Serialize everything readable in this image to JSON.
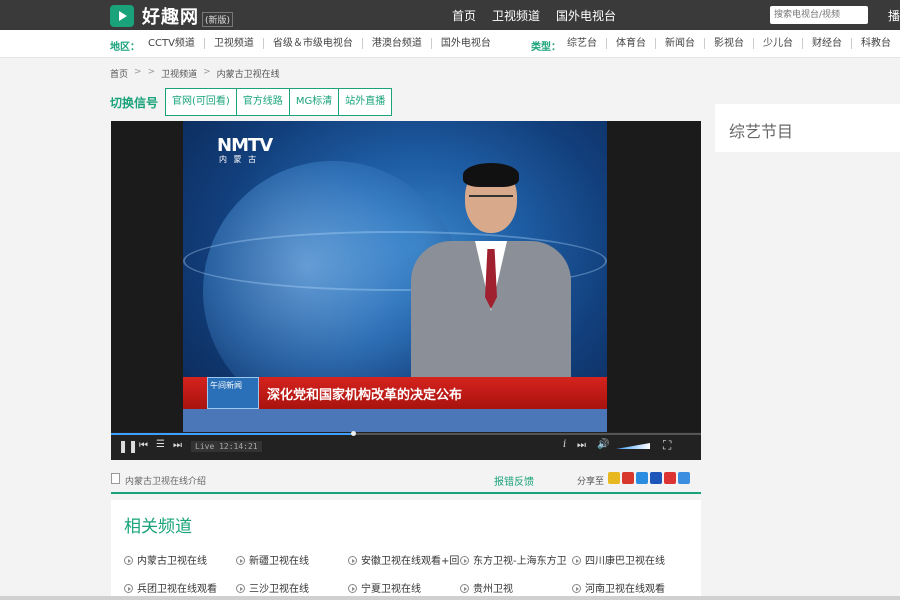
{
  "header": {
    "logo_text": "好趣网",
    "logo_sub": "(新版)",
    "nav": [
      "首页",
      "卫视频道",
      "国外电视台"
    ],
    "search_placeholder": "搜索电视台/视频",
    "more": "播"
  },
  "categories": {
    "region_label": "地区：",
    "region_items": [
      "CCTV频道",
      "卫视频道",
      "省级＆市级电视台",
      "港澳台频道",
      "国外电视台"
    ],
    "type_label": "类型：",
    "type_items": [
      "综艺台",
      "体育台",
      "新闻台",
      "影视台",
      "少儿台",
      "财经台",
      "科教台"
    ]
  },
  "breadcrumb": [
    "首页",
    ">",
    ">",
    "卫视频道",
    ">",
    "内蒙古卫视在线"
  ],
  "signal": {
    "label": "切换信号",
    "tabs": [
      "官网(可回看)",
      "官方线路",
      "MG标清",
      "站外直播"
    ]
  },
  "side": {
    "title": "综艺节目"
  },
  "player": {
    "channel_logo": "NMTV",
    "channel_sub": "内 蒙 古",
    "lower_tag": "午间新闻",
    "headline": "深化党和国家机构改革的决定公布",
    "live_label": "Live",
    "time": "12:14:21",
    "progress": 0.41,
    "volume": 0.9
  },
  "info": {
    "intro": "内蒙古卫视在线介绍",
    "report": "报错反馈",
    "share_label": "分享至",
    "share_colors": [
      "#e8b820",
      "#d8382c",
      "#2a8de0",
      "#1b56b8",
      "#d33",
      "#3b8ee0"
    ]
  },
  "related": {
    "title": "相关频道",
    "row1": [
      "内蒙古卫视在线",
      "新疆卫视在线",
      "安徽卫视在线观看+回",
      "东方卫视-上海东方卫",
      "四川康巴卫视在线"
    ],
    "row2": [
      "兵团卫视在线观看",
      "三沙卫视在线",
      "宁夏卫视在线",
      "贵州卫视",
      "河南卫视在线观看"
    ]
  }
}
